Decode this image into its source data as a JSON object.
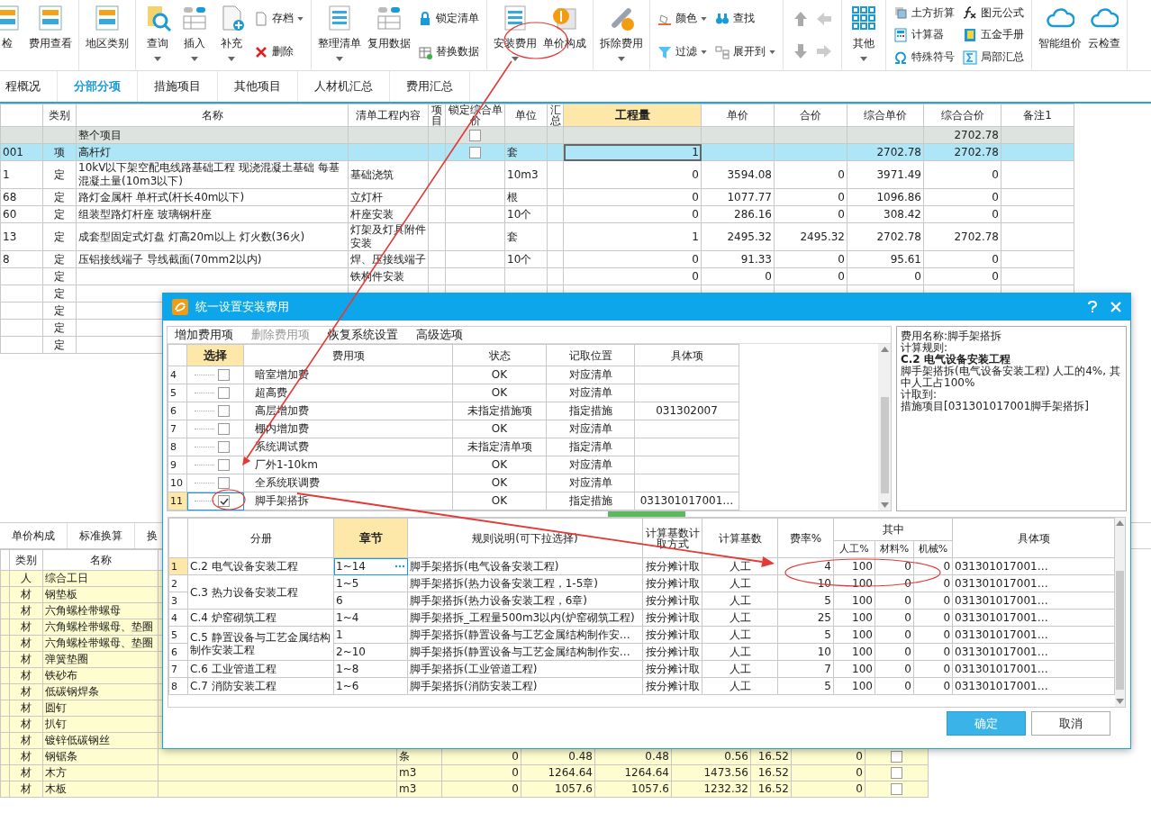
{
  "toolbar": {
    "groups": [
      {
        "kind": "buttons",
        "columns": [
          [
            {
              "label": "检",
              "kind": "large",
              "dropdown": false
            }
          ],
          [
            {
              "label": "费用查看",
              "kind": "large",
              "dropdown": false
            }
          ]
        ]
      },
      {
        "kind": "buttons",
        "columns": [
          [
            {
              "label": "地区类别",
              "kind": "large",
              "dropdown": false
            }
          ]
        ]
      },
      {
        "kind": "buttons",
        "columns": [
          [
            {
              "label": "查询",
              "kind": "large",
              "dropdown": true
            }
          ],
          [
            {
              "label": "插入",
              "kind": "large",
              "dropdown": true
            }
          ],
          [
            {
              "label": "补充",
              "kind": "large",
              "dropdown": true
            }
          ],
          [
            {
              "label": "存档",
              "kind": "small",
              "dropdown": true
            },
            {
              "label": "删除",
              "kind": "small",
              "dropdown": false
            }
          ]
        ]
      },
      {
        "kind": "buttons",
        "columns": [
          [
            {
              "label": "整理清单",
              "kind": "large",
              "dropdown": true
            }
          ],
          [
            {
              "label": "复用数据",
              "kind": "large",
              "dropdown": false
            }
          ],
          [
            {
              "label": "锁定清单",
              "kind": "small",
              "dropdown": false
            },
            {
              "label": "替换数据",
              "kind": "small",
              "dropdown": false
            }
          ]
        ]
      },
      {
        "kind": "buttons",
        "columns": [
          [
            {
              "label": "安装费用",
              "kind": "large",
              "dropdown": true
            }
          ],
          [
            {
              "label": "单价构成",
              "kind": "large",
              "dropdown": false
            }
          ]
        ]
      },
      {
        "kind": "buttons",
        "columns": [
          [
            {
              "label": "拆除费用",
              "kind": "large",
              "dropdown": true
            }
          ]
        ]
      },
      {
        "kind": "buttons",
        "columns": [
          [
            {
              "label": "颜色",
              "kind": "small",
              "dropdown": true
            },
            {
              "label": "过滤",
              "kind": "small",
              "dropdown": true
            }
          ],
          [
            {
              "label": "查找",
              "kind": "small",
              "dropdown": false
            },
            {
              "label": "展开到",
              "kind": "small",
              "dropdown": true
            }
          ]
        ]
      },
      {
        "kind": "arrows"
      },
      {
        "kind": "buttons",
        "columns": [
          [
            {
              "label": "其他",
              "kind": "large",
              "dropdown": true
            }
          ]
        ]
      },
      {
        "kind": "buttons",
        "columns": [
          [
            {
              "label": "土方折算",
              "kind": "small",
              "dropdown": false
            },
            {
              "label": "计算器",
              "kind": "small",
              "dropdown": false
            },
            {
              "label": "特殊符号",
              "kind": "small",
              "dropdown": false
            }
          ],
          [
            {
              "label": "图元公式",
              "kind": "small",
              "dropdown": false
            },
            {
              "label": "五金手册",
              "kind": "small",
              "dropdown": false
            },
            {
              "label": "局部汇总",
              "kind": "small",
              "dropdown": false
            }
          ]
        ]
      },
      {
        "kind": "buttons",
        "columns": [
          [
            {
              "label": "智能组价",
              "kind": "large",
              "dropdown": false
            }
          ],
          [
            {
              "label": "云检查",
              "kind": "large",
              "dropdown": false
            }
          ]
        ]
      }
    ]
  },
  "tabs": [
    {
      "label": "程概况",
      "selected": false
    },
    {
      "label": "分部分项",
      "selected": true
    },
    {
      "label": "措施项目",
      "selected": false
    },
    {
      "label": "其他项目",
      "selected": false
    },
    {
      "label": "人材机汇总",
      "selected": false
    },
    {
      "label": "费用汇总",
      "selected": false
    }
  ],
  "main_table": {
    "columns": [
      {
        "label": "类别",
        "selected": false
      },
      {
        "label": "名称",
        "selected": false
      },
      {
        "label": "清单工程内容",
        "selected": false
      },
      {
        "label": "项目",
        "selected": false
      },
      {
        "label": "锁定综合单价",
        "selected": false
      },
      {
        "label": "单位",
        "selected": false
      },
      {
        "label": "汇总",
        "selected": false
      },
      {
        "label": "工程量",
        "selected": true
      },
      {
        "label": "单价",
        "selected": false
      },
      {
        "label": "合价",
        "selected": false
      },
      {
        "label": "综合单价",
        "selected": false
      },
      {
        "label": "综合合价",
        "selected": false
      },
      {
        "label": "备注1",
        "selected": false
      }
    ],
    "rows": [
      {
        "kind": "total",
        "selected": false,
        "name": "整个项目",
        "locked": false,
        "total_all": "2702.78"
      },
      {
        "kind": "item",
        "selected": true,
        "code": "001",
        "category": "项",
        "name": "高杆灯",
        "locked": false,
        "unit": "套",
        "qty": "1",
        "unit_all": "2702.78",
        "total_all": "2702.78"
      },
      {
        "kind": "item",
        "selected": false,
        "code": "1",
        "category": "定",
        "name": "10kV以下架空配电线路基础工程 现浇混凝土基础 每基混凝土量(10m3以下)",
        "content": "基础浇筑",
        "unit": "10m3",
        "qty": "0",
        "price": "3594.08",
        "total": "0",
        "unit_all": "3971.49",
        "total_all": "0"
      },
      {
        "kind": "item",
        "selected": false,
        "code": "68",
        "category": "定",
        "name": "路灯金属杆 单杆式(杆长40m以下)",
        "content": "立灯杆",
        "unit": "根",
        "qty": "0",
        "price": "1077.77",
        "total": "0",
        "unit_all": "1096.86",
        "total_all": "0"
      },
      {
        "kind": "item",
        "selected": false,
        "code": "60",
        "category": "定",
        "name": "组装型路灯杆座 玻璃钢杆座",
        "content": "杆座安装",
        "unit": "10个",
        "qty": "0",
        "price": "286.16",
        "total": "0",
        "unit_all": "308.42",
        "total_all": "0"
      },
      {
        "kind": "item",
        "selected": false,
        "code": "13",
        "category": "定",
        "name": "成套型固定式灯盘 灯高20m以上 灯火数(36火)",
        "content": "灯架及灯具附件安装",
        "unit": "套",
        "qty": "1",
        "price": "2495.32",
        "total": "2495.32",
        "unit_all": "2702.78",
        "total_all": "2702.78"
      },
      {
        "kind": "item",
        "selected": false,
        "code": "8",
        "category": "定",
        "name": "压铝接线端子 导线截面(70mm2以内)",
        "content": "焊、压接线端子",
        "unit": "10个",
        "qty": "0",
        "price": "91.33",
        "total": "0",
        "unit_all": "95.61",
        "total_all": "0"
      },
      {
        "kind": "item",
        "selected": false,
        "category": "定",
        "content": "铁构件安装",
        "qty": "0",
        "price": "0",
        "total": "0",
        "unit_all": "0",
        "total_all": "0"
      },
      {
        "kind": "item",
        "selected": false,
        "category": "定"
      },
      {
        "kind": "item",
        "selected": false,
        "category": "定"
      },
      {
        "kind": "item",
        "selected": false,
        "category": "定"
      },
      {
        "kind": "item",
        "selected": false,
        "category": "定"
      }
    ]
  },
  "lower_tabs": [
    {
      "label": "单价构成"
    },
    {
      "label": "标准换算"
    },
    {
      "label": "换"
    }
  ],
  "lower_table": {
    "columns": [
      "类别",
      "名称"
    ],
    "rows": [
      {
        "category": "人",
        "name": "综合工日"
      },
      {
        "category": "材",
        "name": "钢垫板"
      },
      {
        "category": "材",
        "name": "六角螺栓带螺母"
      },
      {
        "category": "材",
        "name": "六角螺栓带螺母、垫圈"
      },
      {
        "category": "材",
        "name": "六角螺栓带螺母、垫圈"
      },
      {
        "category": "材",
        "name": "弹簧垫圈"
      },
      {
        "category": "材",
        "name": "铁砂布"
      },
      {
        "category": "材",
        "name": "低碳钢焊条"
      },
      {
        "category": "材",
        "name": "圆钉"
      },
      {
        "category": "材",
        "name": "扒钉"
      },
      {
        "category": "材",
        "name": "镀锌低碳钢丝"
      },
      {
        "category": "材",
        "name": "钢锯条",
        "unit": "条",
        "values": [
          "0",
          "0.48",
          "0.48",
          "0.56",
          "16.52",
          "0"
        ],
        "checked": false
      },
      {
        "category": "材",
        "name": "木方",
        "unit": "m3",
        "values": [
          "0",
          "1264.64",
          "1264.64",
          "1473.56",
          "16.52",
          "0"
        ],
        "checked": false
      },
      {
        "category": "材",
        "name": "木板",
        "unit": "m3",
        "values": [
          "0",
          "1057.6",
          "1057.6",
          "1232.32",
          "16.52",
          "0"
        ],
        "checked": false
      }
    ]
  },
  "dialog": {
    "title": "统一设置安装费用",
    "menu": [
      {
        "label": "增加费用项",
        "disabled": false
      },
      {
        "label": "删除费用项",
        "disabled": true
      },
      {
        "label": "恢复系统设置",
        "disabled": false
      },
      {
        "label": "高级选项",
        "disabled": false
      }
    ],
    "fee_table": {
      "columns": [
        {
          "label": "选择",
          "selected": true
        },
        {
          "label": "费用项",
          "selected": false
        },
        {
          "label": "状态",
          "selected": false
        },
        {
          "label": "记取位置",
          "selected": false
        },
        {
          "label": "具体项",
          "selected": false
        }
      ],
      "rows": [
        {
          "no": "4",
          "checked": false,
          "selected": false,
          "name": "暗室增加费",
          "status": "OK",
          "position": "对应清单"
        },
        {
          "no": "5",
          "checked": false,
          "selected": false,
          "name": "超高费",
          "status": "OK",
          "position": "对应清单"
        },
        {
          "no": "6",
          "checked": false,
          "selected": false,
          "name": "高层增加费",
          "status": "未指定措施项",
          "position": "指定措施",
          "item": "031302007"
        },
        {
          "no": "7",
          "checked": false,
          "selected": false,
          "name": "棚内增加费",
          "status": "OK",
          "position": "对应清单"
        },
        {
          "no": "8",
          "checked": false,
          "selected": false,
          "name": "系统调试费",
          "status": "未指定清单项",
          "position": "指定清单"
        },
        {
          "no": "9",
          "checked": false,
          "selected": false,
          "name": "厂外1-10km",
          "status": "OK",
          "position": "对应清单"
        },
        {
          "no": "10",
          "checked": false,
          "selected": false,
          "name": "全系统联调费",
          "status": "OK",
          "position": "对应清单"
        },
        {
          "no": "11",
          "checked": true,
          "selected": true,
          "name": "脚手架搭拆",
          "status": "OK",
          "position": "指定措施",
          "item": "031301017001…"
        }
      ]
    },
    "info": [
      {
        "text": "费用名称:脚手架搭拆",
        "bold": false
      },
      {
        "text": "计算规则:",
        "bold": false
      },
      {
        "text": "C.2 电气设备安装工程",
        "bold": true
      },
      {
        "text": "脚手架搭拆(电气设备安装工程) 人工的4%, 其中人工占100%",
        "bold": false
      },
      {
        "text": "计取到:",
        "bold": false
      },
      {
        "text": "措施项目[031301017001脚手架搭拆]",
        "bold": false
      }
    ],
    "rule_table": {
      "columns": [
        {
          "label": "分册",
          "selected": false
        },
        {
          "label": "章节",
          "selected": true
        },
        {
          "label": "规则说明(可下拉选择)",
          "selected": false
        },
        {
          "label": "计算基数计取方式",
          "selected": false
        },
        {
          "label": "计算基数",
          "selected": false
        },
        {
          "label": "费率%",
          "selected": false
        }
      ],
      "group": {
        "label": "其中",
        "columns": [
          "人工%",
          "材料%",
          "机械%"
        ]
      },
      "last_column": "具体项",
      "volumes": [
        {
          "name": "C.2 电气设备安装工程",
          "rows": [
            {
              "no": "1",
              "selected": true,
              "chapter": "1~14",
              "rule": "脚手架搭拆(电气设备安装工程)",
              "method": "按分摊计取",
              "base": "人工",
              "rate": "4",
              "labor": "100",
              "material": "0",
              "machine": "0",
              "item": "031301017001…"
            }
          ]
        },
        {
          "name": "C.3 热力设备安装工程",
          "rows": [
            {
              "no": "2",
              "selected": false,
              "chapter": "1~5",
              "rule": "脚手架搭拆(热力设备安装工程，1-5章)",
              "method": "按分摊计取",
              "base": "人工",
              "rate": "10",
              "labor": "100",
              "material": "0",
              "machine": "0",
              "item": "031301017001…"
            },
            {
              "no": "3",
              "selected": false,
              "chapter": "6",
              "rule": "脚手架搭拆(热力设备安装工程，6章)",
              "method": "按分摊计取",
              "base": "人工",
              "rate": "5",
              "labor": "100",
              "material": "0",
              "machine": "0",
              "item": "031301017001…"
            }
          ]
        },
        {
          "name": "C.4 炉窑砌筑工程",
          "rows": [
            {
              "no": "4",
              "selected": false,
              "chapter": "1~4",
              "rule": "脚手架搭拆_工程量500m3以内(炉窑砌筑工程)",
              "method": "按分摊计取",
              "base": "人工",
              "rate": "25",
              "labor": "100",
              "material": "0",
              "machine": "0",
              "item": "031301017001…"
            }
          ]
        },
        {
          "name": "C.5 静置设备与工艺金属结构制作安装工程",
          "rows": [
            {
              "no": "5",
              "selected": false,
              "chapter": "1",
              "rule": "脚手架搭拆(静置设备与工艺金属结构制作安…",
              "method": "按分摊计取",
              "base": "人工",
              "rate": "5",
              "labor": "100",
              "material": "0",
              "machine": "0",
              "item": "031301017001…"
            },
            {
              "no": "6",
              "selected": false,
              "chapter": "2~10",
              "rule": "脚手架搭拆(静置设备与工艺金属结构制作安…",
              "method": "按分摊计取",
              "base": "人工",
              "rate": "10",
              "labor": "100",
              "material": "0",
              "machine": "0",
              "item": "031301017001…"
            }
          ]
        },
        {
          "name": "C.6 工业管道工程",
          "rows": [
            {
              "no": "7",
              "selected": false,
              "chapter": "1~8",
              "rule": "脚手架搭拆(工业管道工程)",
              "method": "按分摊计取",
              "base": "人工",
              "rate": "7",
              "labor": "100",
              "material": "0",
              "machine": "0",
              "item": "031301017001…"
            }
          ]
        },
        {
          "name": "C.7 消防安装工程",
          "rows": [
            {
              "no": "8",
              "selected": false,
              "chapter": "1~6",
              "rule": "脚手架搭拆(消防安装工程)",
              "method": "按分摊计取",
              "base": "人工",
              "rate": "5",
              "labor": "100",
              "material": "0",
              "machine": "0",
              "item": "031301017001…"
            }
          ]
        }
      ]
    },
    "buttons": [
      {
        "label": "确定",
        "primary": true
      },
      {
        "label": "取消",
        "primary": false
      }
    ]
  }
}
